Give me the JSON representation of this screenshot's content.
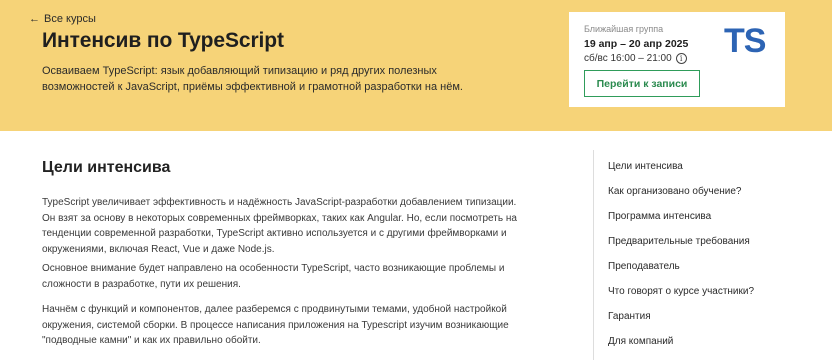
{
  "hero": {
    "back_label": "Все курсы",
    "title": "Интенсив по TypeScript",
    "description": "Осваиваем TypeScript: язык добавляющий типизацию и ряд других полезных возможностей к JavaScript, приёмы эффективной и грамотной разработки на нём."
  },
  "group": {
    "label": "Ближайшая группа",
    "dates": "19 апр – 20 апр 2025",
    "schedule": "сб/вс 16:00 – 21:00",
    "button_label": "Перейти к записи",
    "logo_text": "TS"
  },
  "main": {
    "section_title": "Цели интенсива",
    "paragraphs": [
      "TypeScript увеличивает эффективность и надёжность JavaScript-разработки добавлением типизации. Он взят за основу в некоторых современных фреймворках, таких как Angular. Но, если посмотреть на тенденции современной разработки, TypeScript активно используется и с другими фреймворками и окружениями, включая React, Vue и даже Node.js.",
      "Основное внимание будет направлено на особенности TypeScript, часто возникающие проблемы и сложности в разработке, пути их решения.",
      "Начнём с функций и компонентов, далее разберемся с продвинутыми темами, удобной настройкой окружения, системой сборки. В процессе написания приложения на Typescript изучим возникающие \"подводные камни\" и как их правильно обойти."
    ]
  },
  "toc": {
    "items": [
      "Цели интенсива",
      "Как организовано обучение?",
      "Программа интенсива",
      "Предварительные требования",
      "Преподаватель",
      "Что говорят о курсе участники?",
      "Гарантия",
      "Для компаний"
    ]
  },
  "colors": {
    "hero_background": "#f6d378",
    "accent_green": "#2f9c5a",
    "ts_blue": "#2d64b4"
  }
}
